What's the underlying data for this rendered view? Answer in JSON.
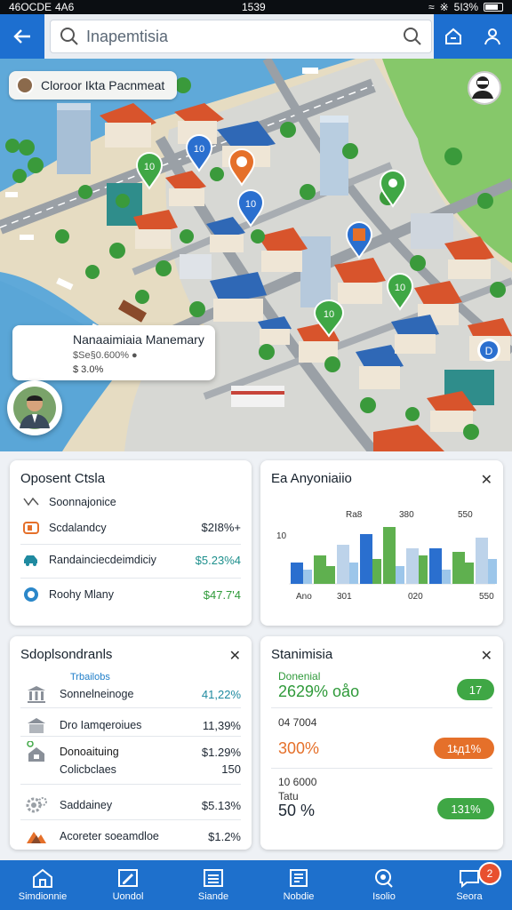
{
  "status_bar": {
    "carrier": "46OCDE",
    "network": "4A6",
    "time": "1539",
    "battery": "5I3%"
  },
  "search": {
    "value": "Inapemtisia"
  },
  "map": {
    "location_pill": "Cloroor Ikta Pacnmeat",
    "pins": [
      "10",
      "10",
      "10",
      "10",
      "10",
      "D"
    ],
    "profile": {
      "name": "Nanaaimiaia Manemary",
      "subtitle": "$Se§0.600% ●",
      "value": "$ 3.0%"
    }
  },
  "panel_overview": {
    "title": "Oposent Ctsla",
    "rows": [
      {
        "icon": "chart-line-icon",
        "label": "Soonnajonice",
        "value": ""
      },
      {
        "icon": "card-icon",
        "label": "Scdalandcy",
        "value": "$2I8%+"
      },
      {
        "icon": "car-icon",
        "label": "Randainciecdeimdiciy",
        "value": "$5.23%4"
      },
      {
        "icon": "coin-icon",
        "label": "Roohy Mlany",
        "value": "$47.7'4"
      }
    ]
  },
  "panel_chart": {
    "title": "Ea Anyoniaiio",
    "chart_data": {
      "type": "bar",
      "categories": [
        "Ano",
        "301",
        "",
        "020",
        "",
        "550"
      ],
      "top_labels": [
        "Ra8",
        "",
        "380",
        "",
        "550"
      ],
      "ytick": "10",
      "series": [
        {
          "name": "",
          "values": [
            6,
            8,
            11,
            14,
            16,
            10,
            10,
            9,
            13
          ]
        },
        {
          "name": "",
          "values": [
            4,
            5,
            6,
            7,
            5,
            8,
            4,
            6,
            7
          ]
        },
        {
          "name": "",
          "values": [
            10,
            3,
            4,
            6,
            5,
            6,
            3,
            5,
            5
          ]
        }
      ]
    }
  },
  "panel_stores": {
    "title": "Sdoplsondranls",
    "rows": [
      {
        "icon": "bank-icon",
        "label_top": "Trbailobs",
        "label": "Sonnelneinoge",
        "value": "41,22%"
      },
      {
        "icon": "building-icon",
        "label": "Dro Iamqeroiues",
        "value": "11,39%"
      },
      {
        "icon": "house-icon",
        "label": "Donoaituing",
        "value": "$1.29%"
      },
      {
        "icon": "",
        "label": "Colicbclaes",
        "value": "150"
      },
      {
        "icon": "gear-icon",
        "label": "Saddainey",
        "value": "$5.13%"
      },
      {
        "icon": "mountain-icon",
        "label": "Acoreter soeamdloe",
        "value": "$1.2%"
      }
    ]
  },
  "panel_stats": {
    "title": "Stanimisia",
    "items": [
      {
        "label": "Donenial",
        "big": "2629% oåo",
        "pill": "17"
      },
      {
        "label": "04 7004",
        "big": "300%",
        "pill": "1ȶд1%"
      },
      {
        "label": "10 6000\nTatu",
        "big": "50 %",
        "pill": "131%"
      }
    ],
    "colors": {
      "green": "#3fa745",
      "orange": "#e5702a"
    }
  },
  "nav": [
    {
      "label": "Simdionnie",
      "icon": "home-icon"
    },
    {
      "label": "Uondol",
      "icon": "edit-icon"
    },
    {
      "label": "Siande",
      "icon": "list-icon"
    },
    {
      "label": "Nobdie",
      "icon": "document-icon"
    },
    {
      "label": "Isolio",
      "icon": "search-icon"
    },
    {
      "label": "Seora",
      "icon": "chat-icon",
      "badge": "2"
    }
  ]
}
